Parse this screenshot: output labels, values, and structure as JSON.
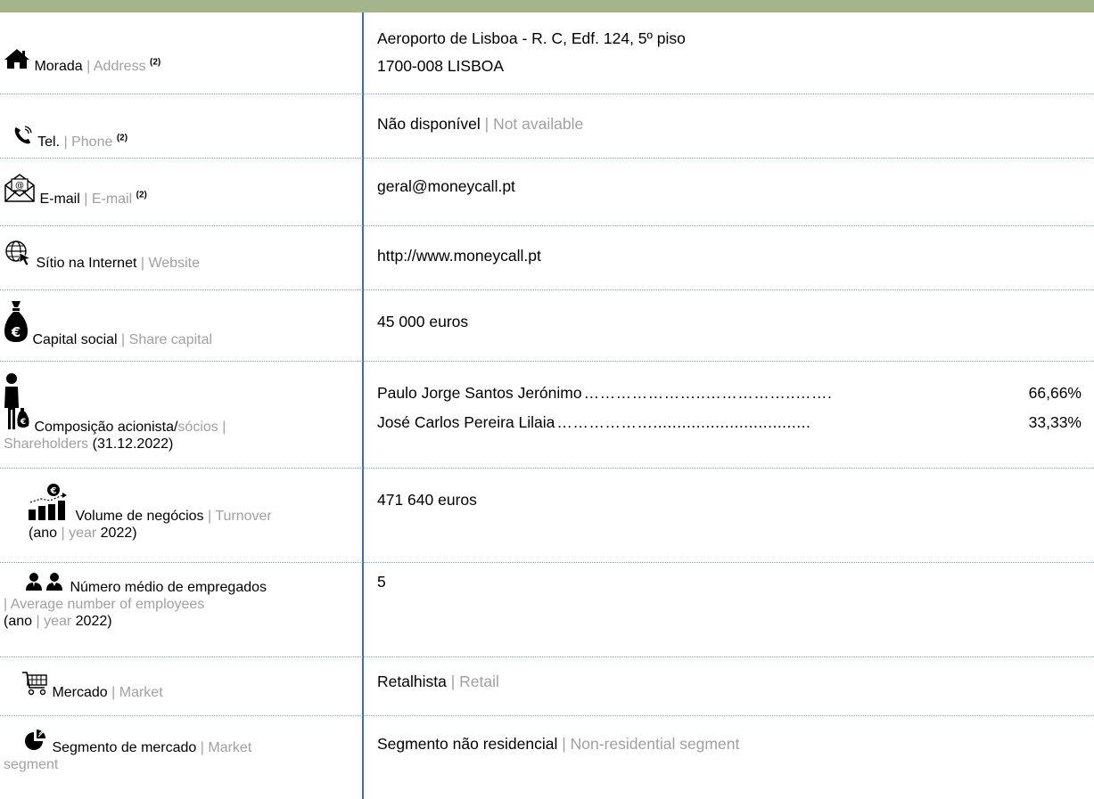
{
  "rows": [
    {
      "label_pt": "Morada",
      "label_en": "Address",
      "note": "(2)",
      "value_lines": [
        "Aeroporto de Lisboa - R. C, Edf. 124, 5º piso",
        "1700-008 LISBOA"
      ],
      "icon": "house-icon"
    },
    {
      "label_pt": "Tel.",
      "label_en": "Phone",
      "note": "(2)",
      "value_pt": "Não disponível",
      "value_en": "Not available",
      "icon": "phone-icon"
    },
    {
      "label_pt": "E-mail",
      "label_en": "E-mail",
      "note": "(2)",
      "value": "geral@moneycall.pt",
      "icon": "envelope-icon"
    },
    {
      "label_pt": "Sítio na Internet",
      "label_en": "Website",
      "value": "http://www.moneycall.pt",
      "icon": "globe-cursor-icon"
    },
    {
      "label_pt": "Capital social",
      "label_en": "Share capital",
      "value": "45 000 euros",
      "icon": "money-bag-icon"
    },
    {
      "label_pt": "Composição acionista/",
      "label_pt2": "sócios",
      "label_sep": " | ",
      "label_en": "Shareholders",
      "label_date": " (31.12.2022)",
      "icon": "shareholder-icon",
      "shareholders": [
        {
          "name": "Paulo Jorge Santos Jerónimo",
          "dots": "…………………..……………..…….",
          "pct": "66,66%"
        },
        {
          "name": "José Carlos Pereira Lilaia",
          "dots": "……………….................................",
          "pct": "33,33%"
        }
      ]
    },
    {
      "label_pt": "Volume de negócios",
      "label_en": "Turnover",
      "year_open": "(ano",
      "year_en": "year",
      "year_val": "2022)",
      "value": "471 640 euros",
      "icon": "turnover-chart-icon"
    },
    {
      "label_pt": "Número médio de empregados",
      "label_en": "Average number of employees",
      "year_open": "(ano",
      "year_en": "year",
      "year_val": "2022)",
      "value": "5",
      "icon": "employees-icon"
    },
    {
      "label_pt": "Mercado",
      "label_en": "Market",
      "value_pt": "Retalhista",
      "value_en": "Retail",
      "icon": "shopping-cart-icon"
    },
    {
      "label_pt": "Segmento de mercado",
      "label_en": "Market",
      "label_en2": "segment",
      "value_pt": "Segmento não residencial",
      "value_en": "Non-residential segment",
      "icon": "market-segment-icon"
    }
  ],
  "colors": {
    "top_bar": "#a4b589",
    "divider": "#3a6fb7",
    "grey_text": "#a0a0a0",
    "row_separator": "#7aa2c8"
  }
}
